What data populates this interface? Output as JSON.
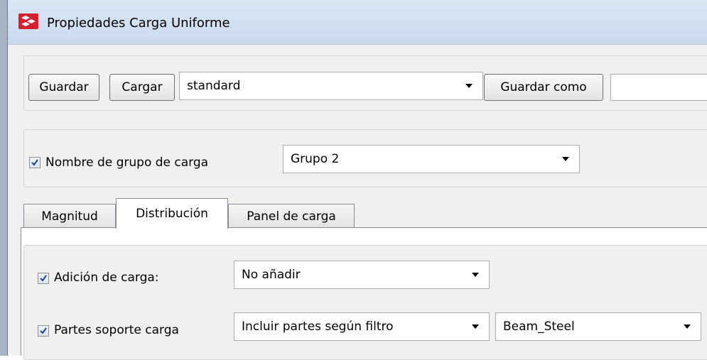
{
  "window": {
    "title": "Propiedades Carga Uniforme"
  },
  "toolbar": {
    "save_label": "Guardar",
    "load_label": "Cargar",
    "preset_value": "standard",
    "save_as_label": "Guardar como",
    "save_as_name": ""
  },
  "load_group": {
    "checked": true,
    "label": "Nombre de grupo de carga",
    "value": "Grupo 2"
  },
  "tabs": [
    {
      "label": "Magnitud",
      "active": false
    },
    {
      "label": "Distribución",
      "active": true
    },
    {
      "label": "Panel de carga",
      "active": false
    }
  ],
  "distribution": {
    "load_addition": {
      "checked": true,
      "label": "Adición de carga:",
      "value": "No añadir"
    },
    "bearing_parts": {
      "checked": true,
      "label": "Partes soporte carga",
      "mode_value": "Incluir partes según filtro",
      "filter_value": "Beam_Steel"
    }
  },
  "colors": {
    "highlight": "#e30000",
    "titlebar": "#c9d9ee"
  }
}
